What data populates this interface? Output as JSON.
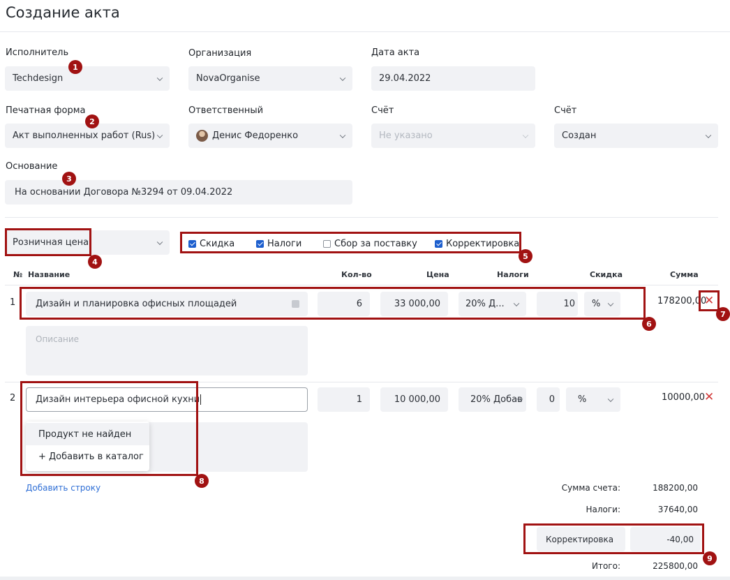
{
  "page": {
    "title": "Создание акта"
  },
  "form": {
    "executor": {
      "label": "Исполнитель",
      "value": "Techdesign"
    },
    "organization": {
      "label": "Организация",
      "value": "NovaOrganise"
    },
    "act_date": {
      "label": "Дата акта",
      "value": "29.04.2022"
    },
    "print_form": {
      "label": "Печатная форма",
      "value": "Акт выполненных работ (Rus)"
    },
    "responsible": {
      "label": "Ответственный",
      "value": "Денис Федоренко"
    },
    "invoice": {
      "label": "Счёт",
      "value": "Не указано"
    },
    "status": {
      "label": "Счёт",
      "value": "Создан"
    },
    "basis": {
      "label": "Основание",
      "value": "На основании Договора №3294 от 09.04.2022"
    }
  },
  "price_type": {
    "value": "Розничная цена"
  },
  "options": [
    {
      "label": "Скидка",
      "checked": true
    },
    {
      "label": "Налоги",
      "checked": true
    },
    {
      "label": "Сбор за поставку",
      "checked": false
    },
    {
      "label": "Корректировка",
      "checked": true
    }
  ],
  "table": {
    "headers": {
      "num": "№",
      "name": "Название",
      "qty": "Кол-во",
      "price": "Цена",
      "tax": "Налоги",
      "discount": "Скидка",
      "sum": "Сумма"
    },
    "rows": [
      {
        "num": "1",
        "name": "Дизайн и планировка офисных площадей",
        "description_placeholder": "Описание",
        "qty": "6",
        "price": "33 000,00",
        "tax": "20% Д...",
        "discount": "10",
        "discount_unit": "%",
        "sum": "178200,00"
      },
      {
        "num": "2",
        "name": "Дизайн интерьера офисной кухни",
        "qty": "1",
        "price": "10 000,00",
        "tax": "20% Добав",
        "discount": "0",
        "discount_unit": "%",
        "sum": "10000,00"
      }
    ]
  },
  "dropdown": {
    "items": [
      "Продукт не найден",
      "+ Добавить в каталог"
    ]
  },
  "add_row": "Добавить строку",
  "totals": {
    "invoice_sum_label": "Сумма счета:",
    "invoice_sum": "188200,00",
    "taxes_label": "Налоги:",
    "taxes": "37640,00",
    "correction_label": "Корректировка",
    "correction": "-40,00",
    "total_label": "Итого:",
    "total": "225800,00"
  },
  "annotations": [
    "1",
    "2",
    "3",
    "4",
    "5",
    "6",
    "7",
    "8",
    "9"
  ],
  "colors": {
    "annotation": "#a11212",
    "checkbox": "#1d5fce",
    "delete": "#d23a3a",
    "link": "#2f6fd6"
  }
}
